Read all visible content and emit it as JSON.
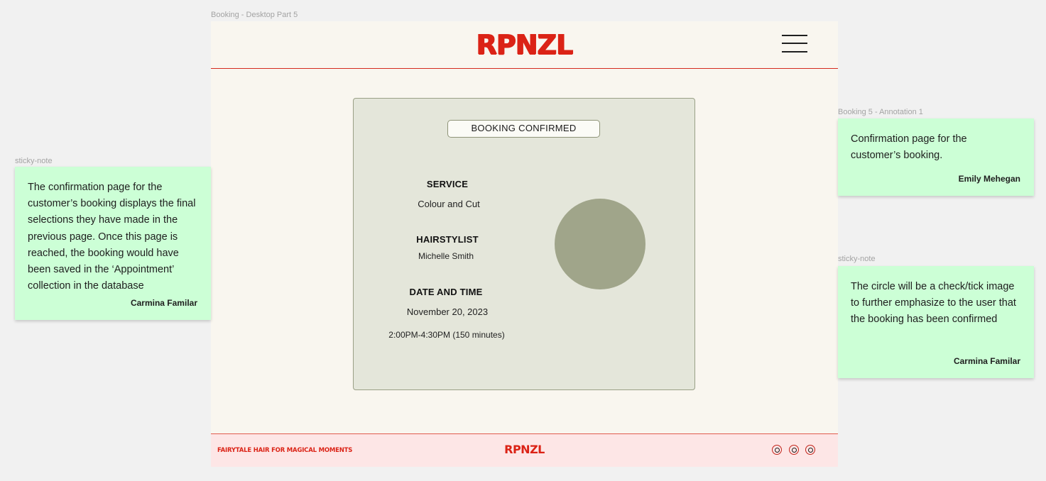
{
  "labels": {
    "main_frame": "Booking - Desktop Part 5",
    "left_note": "sticky-note",
    "annotation": "Booking 5 - Annotation 1",
    "right_note": "sticky-note"
  },
  "header": {
    "logo": "RPNZL",
    "menu_icon": "hamburger-menu-icon"
  },
  "card": {
    "status": "BOOKING CONFIRMED",
    "service_label": "SERVICE",
    "service_value": "Colour and Cut",
    "stylist_label": "HAIRSTYLIST",
    "stylist_value": "Michelle Smith",
    "datetime_label": "DATE AND TIME",
    "date_value": "November 20, 2023",
    "time_value": "2:00PM-4:30PM (150 minutes)"
  },
  "footer": {
    "tagline": "FAIRYTALE HAIR FOR MAGICAL MOMENTS",
    "logo": "RPNZL",
    "social_icons": [
      "threads-icon",
      "facebook-icon",
      "instagram-icon"
    ]
  },
  "notes": {
    "left": {
      "text": "The confirmation page for the customer’s booking displays the final selections they have made in the previous page. Once this page is reached, the booking would have been saved in the ‘Appointment’ collection in the database",
      "author": "Carmina Familar"
    },
    "annotation": {
      "text": "Confirmation page for the customer’s booking.",
      "author": "Emily Mehegan"
    },
    "right": {
      "text": "The circle will be a check/tick image to further emphasize to the user that the booking has been confirmed",
      "author": "Carmina Familar"
    }
  },
  "colors": {
    "brand_red": "#db2316",
    "page_bg": "#f9f6ef",
    "card_bg": "#e4e6da",
    "circle": "#a0a58a",
    "footer_bg": "#fde6e6",
    "sticky": "#ccffd6"
  }
}
